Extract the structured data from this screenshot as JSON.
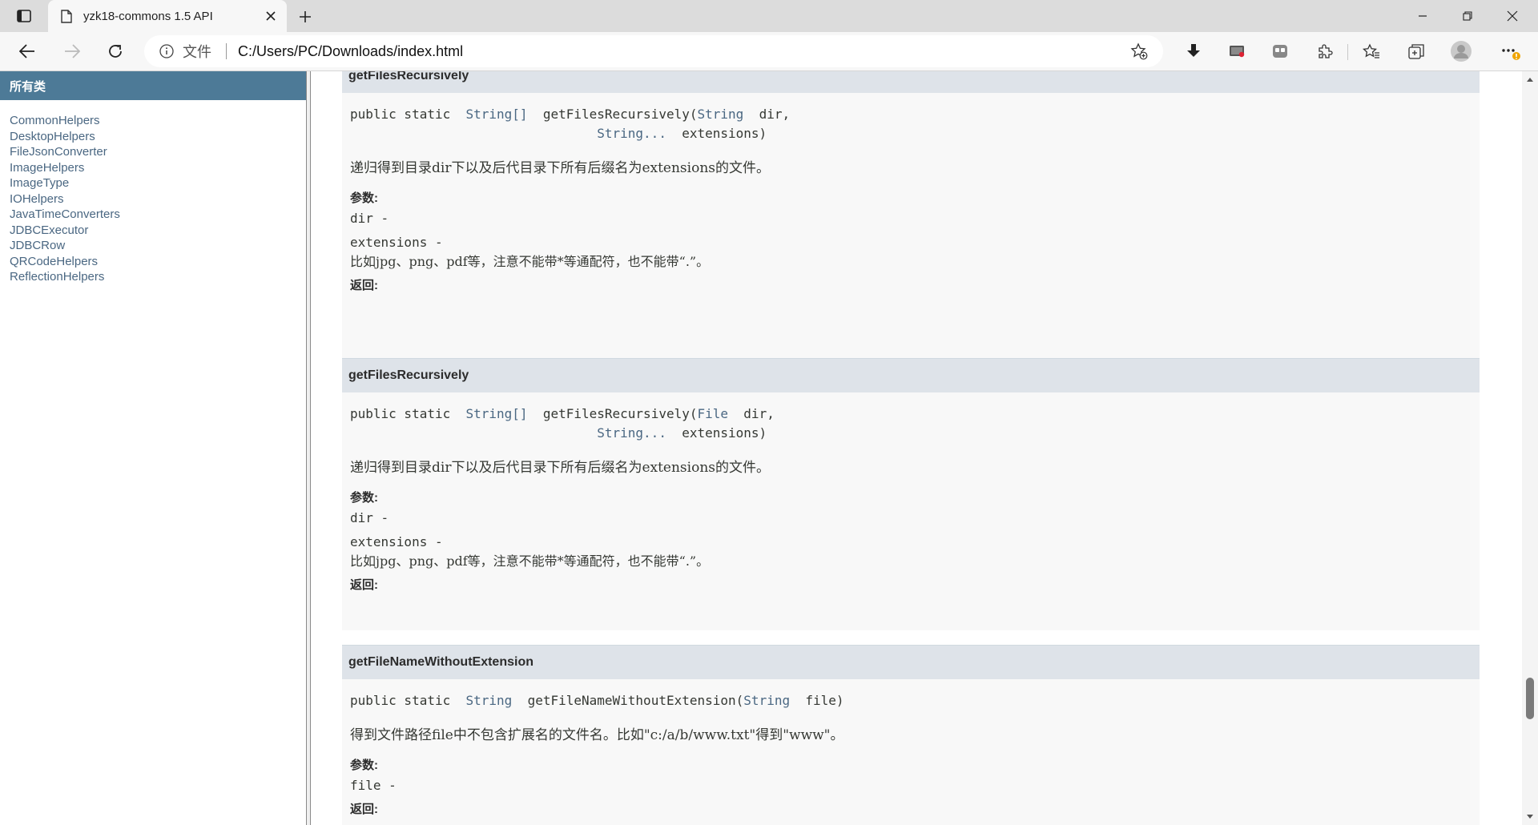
{
  "browser": {
    "tab": {
      "title": "yzk18-commons 1.5 API"
    },
    "address": {
      "scheme_label": "文件",
      "url": "C:/Users/PC/Downloads/index.html"
    }
  },
  "left_frame": {
    "header": "所有类",
    "classes": [
      "CommonHelpers",
      "DesktopHelpers",
      "FileJsonConverter",
      "ImageHelpers",
      "ImageType",
      "IOHelpers",
      "JavaTimeConverters",
      "JDBCExecutor",
      "JDBCRow",
      "QRCodeHelpers",
      "ReflectionHelpers"
    ]
  },
  "methods": [
    {
      "name": "getFilesRecursively",
      "sig_prefix": "public static ",
      "sig_return": "String[]",
      "sig_method": "getFilesRecursively",
      "sig_p1_type": "String",
      "sig_p1_name": "dir,",
      "sig_p2_type": "String...",
      "sig_p2_name": "extensions)",
      "description": "递归得到目录dir下以及后代目录下所有后缀名为extensions的文件。",
      "params_label": "参数:",
      "param1": "dir -",
      "param2": "extensions -",
      "param2_desc": "比如jpg、png、pdf等，注意不能带*等通配符，也不能带“.”。",
      "returns_label": "返回:"
    },
    {
      "name": "getFilesRecursively",
      "sig_prefix": "public static ",
      "sig_return": "String[]",
      "sig_method": "getFilesRecursively",
      "sig_p1_type": "File",
      "sig_p1_name": "dir,",
      "sig_p2_type": "String...",
      "sig_p2_name": "extensions)",
      "description": "递归得到目录dir下以及后代目录下所有后缀名为extensions的文件。",
      "params_label": "参数:",
      "param1": "dir -",
      "param2": "extensions -",
      "param2_desc": "比如jpg、png、pdf等，注意不能带*等通配符，也不能带“.”。",
      "returns_label": "返回:"
    },
    {
      "name": "getFileNameWithoutExtension",
      "sig_prefix": "public static ",
      "sig_return": "String",
      "sig_method": "getFileNameWithoutExtension",
      "sig_p1_type": "String",
      "sig_p1_name": "file)",
      "description": "得到文件路径file中不包含扩展名的文件名。比如\"c:/a/b/www.txt\"得到\"www\"。",
      "params_label": "参数:",
      "param1": "file -",
      "returns_label": "返回:"
    }
  ],
  "colors": {
    "header_blue": "#4d7a97",
    "link": "#4a6782",
    "method_title_bg": "#dee3e9"
  }
}
